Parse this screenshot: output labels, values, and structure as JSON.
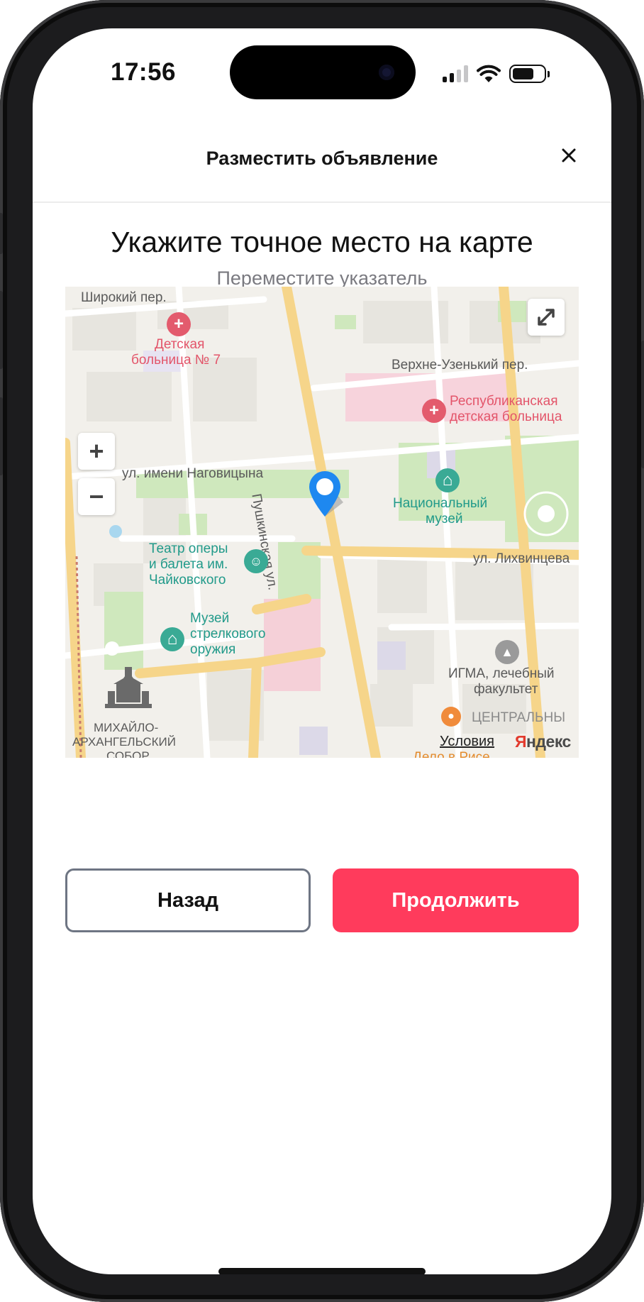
{
  "status_bar": {
    "time": "17:56"
  },
  "header": {
    "title": "Разместить объявление",
    "close_icon": "close-icon"
  },
  "main": {
    "title": "Укажите точное место на карте",
    "subtitle": "Переместите указатель"
  },
  "map": {
    "streets": {
      "shirokiy": "Широкий пер.",
      "verkhne": "Верхне-Узенький пер.",
      "nagovitsyna": "ул. имени Наговицына",
      "pushkinskaya": "Пушкинская ул.",
      "likhvintseva": "ул. Лихвинцева"
    },
    "places": {
      "hospital7": [
        "Детская",
        "больница № 7"
      ],
      "republican": [
        "Республиканская",
        "детская больница"
      ],
      "museum": [
        "Национальный",
        "музей"
      ],
      "theatre": [
        "Театр оперы",
        "и балета им.",
        "Чайковского"
      ],
      "weapons": [
        "Музей",
        "стрелкового",
        "оружия"
      ],
      "igma": [
        "ИГМА, лечебный",
        "факультет"
      ],
      "cathedral": [
        "МИХАЙЛО-",
        "АРХАНГЕЛЬСКИЙ",
        "СОБОР"
      ],
      "central": "ЦЕНТРАЛЬНЫ",
      "delo": "Дело в Рисе"
    },
    "controls": {
      "zoom_in": "+",
      "zoom_out": "−"
    },
    "terms_link": "Условия",
    "provider_logo": "Яндекс"
  },
  "actions": {
    "back_label": "Назад",
    "continue_label": "Продолжить"
  },
  "colors": {
    "accent": "#ff3b5c",
    "marker": "#1e88f0"
  }
}
